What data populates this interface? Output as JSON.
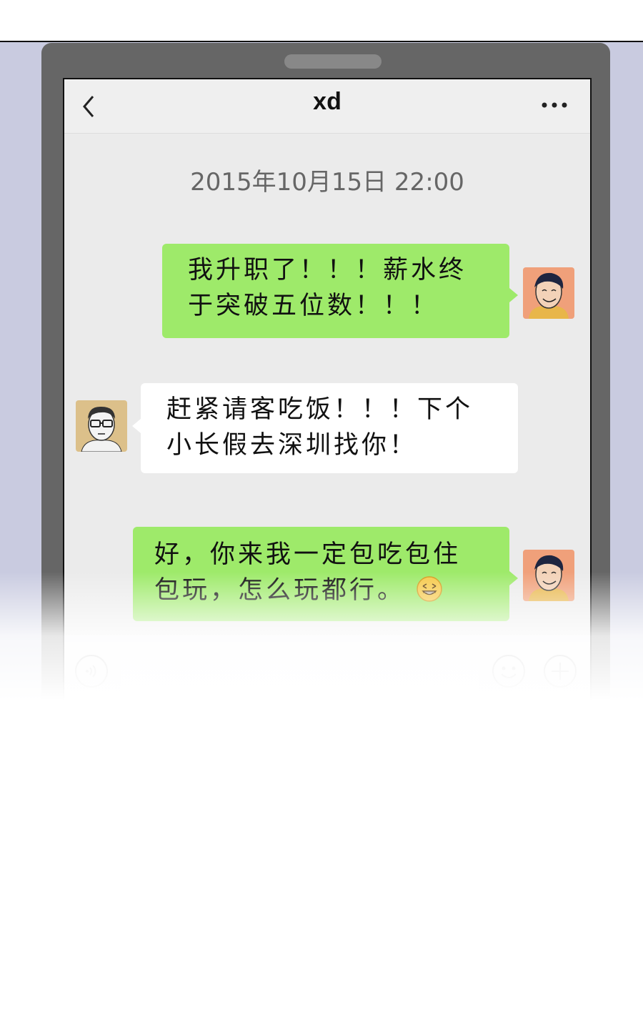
{
  "chat": {
    "contact_name": "xd",
    "timestamp": "2015年10月15日 22:00"
  },
  "messages": [
    {
      "sender": "self",
      "color": "#9eea6a",
      "line1": "我升职了！！！薪水终",
      "line2": "于突破五位数！！！"
    },
    {
      "sender": "friend",
      "color": "#ffffff",
      "line1": "赶紧请客吃饭！！！下个",
      "line2": "小长假去深圳找你！"
    },
    {
      "sender": "self",
      "color": "#9eea6a",
      "line1": "好，你来我一定包吃包住",
      "line2": "包玩，怎么玩都行。",
      "emoji": "grin-emoji"
    }
  ],
  "colors": {
    "panel_background": "#c9cbe0",
    "phone_frame": "#666666",
    "screen_background": "#ebebeb",
    "self_bubble": "#9eea6a",
    "friend_bubble": "#ffffff"
  },
  "icons": {
    "back": "chevron-left-icon",
    "more": "more-dots-icon",
    "voice": "voice-icon",
    "emoji": "smiley-icon",
    "plus": "plus-icon"
  }
}
